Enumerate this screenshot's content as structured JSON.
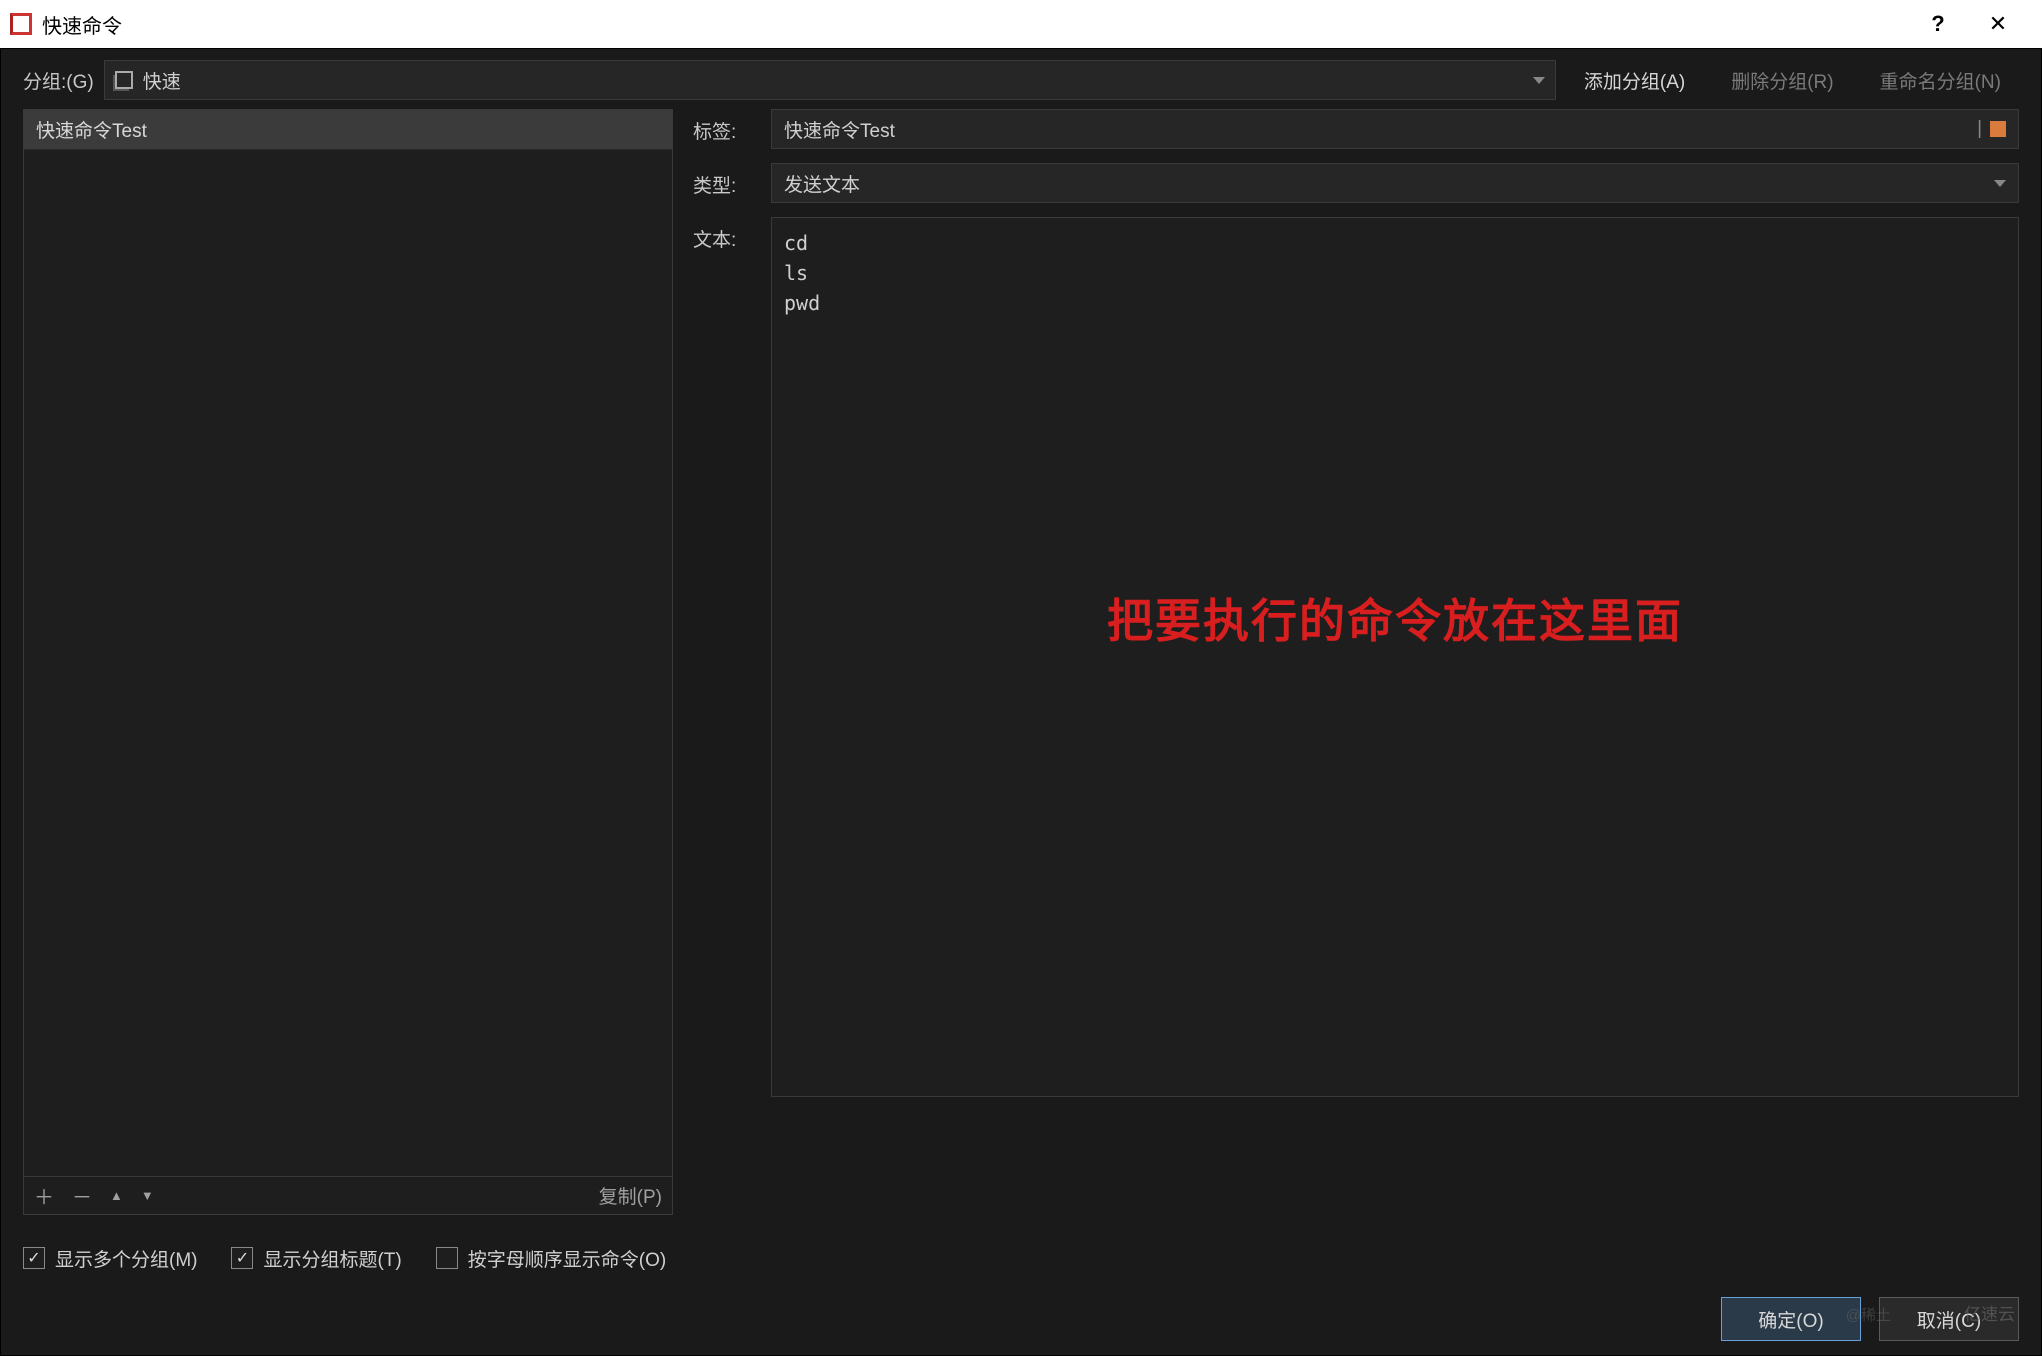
{
  "window": {
    "title": "快速命令",
    "help": "?",
    "close": "✕"
  },
  "toolbar": {
    "group_label": "分组:(G)",
    "group_selected": "快速",
    "add_group": "添加分组(A)",
    "delete_group": "删除分组(R)",
    "rename_group": "重命名分组(N)"
  },
  "list": {
    "items": [
      "快速命令Test"
    ],
    "add": "＋",
    "remove": "－",
    "up": "▲",
    "down": "▼",
    "copy": "复制(P)"
  },
  "form": {
    "label_tag": "标签:",
    "tag_value": "快速命令Test",
    "tag_marker": "|",
    "label_type": "类型:",
    "type_value": "发送文本",
    "label_text": "文本:",
    "text_value": "cd\nls\npwd",
    "overlay_annotation": "把要执行的命令放在这里面"
  },
  "checks": {
    "show_multi_group": {
      "label": "显示多个分组(M)",
      "checked": true
    },
    "show_group_title": {
      "label": "显示分组标题(T)",
      "checked": true
    },
    "alpha_order": {
      "label": "按字母顺序显示命令(O)",
      "checked": false
    }
  },
  "actions": {
    "ok": "确定(O)",
    "cancel": "取消(C)"
  },
  "watermark": "亿速云",
  "watermark2": "@稀土"
}
